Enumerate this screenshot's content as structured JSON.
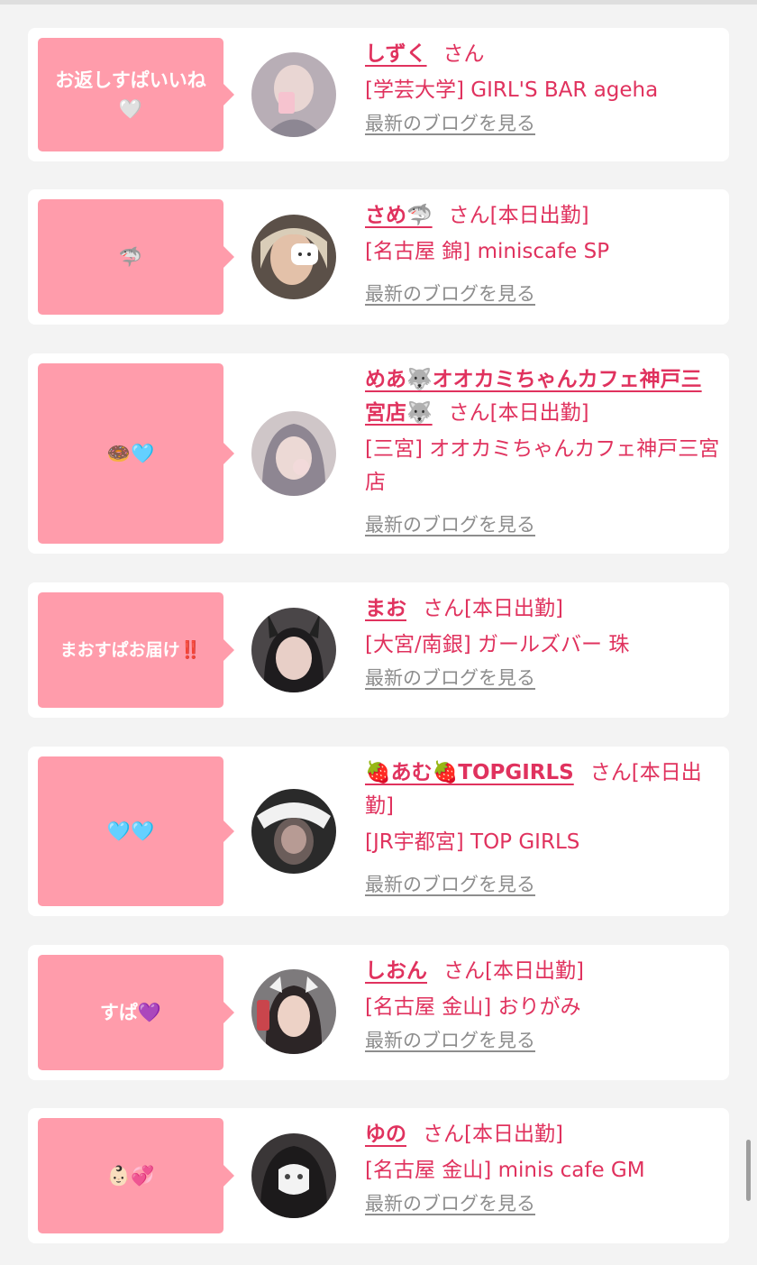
{
  "colors": {
    "accent": "#e0325e",
    "bubble": "#ff9cab",
    "link_gray": "#8d8d8d"
  },
  "blog_link_label": "最新のブログを見る",
  "entries": [
    {
      "message": "お返しすぱいいね🤍",
      "name": "しずく",
      "suffix": "さん",
      "shop": "[学芸大学] GIRL'S BAR ageha"
    },
    {
      "message": "🦈",
      "name": "さめ🦈",
      "suffix": "さん[本日出勤]",
      "shop": "[名古屋 錦] miniscafe SP"
    },
    {
      "message": "🍩🩵",
      "name": "めあ🐺オオカミちゃんカフェ神戸三宮店🐺",
      "suffix": "さん[本日出勤]",
      "shop": "[三宮] オオカミちゃんカフェ神戸三宮店"
    },
    {
      "message": "まおすぱお届け‼️",
      "name": "まお",
      "suffix": "さん[本日出勤]",
      "shop": "[大宮/南銀] ガールズバー 珠"
    },
    {
      "message": "🩵🩵",
      "name": "🍓あむ🍓TOPGIRLS",
      "suffix": "さん[本日出勤]",
      "shop": "[JR宇都宮] TOP GIRLS"
    },
    {
      "message": "すぱ💜",
      "name": "しおん",
      "suffix": "さん[本日出勤]",
      "shop": "[名古屋 金山] おりがみ"
    },
    {
      "message": "👶🏻💞",
      "name": "ゆの",
      "suffix": "さん[本日出勤]",
      "shop": "[名古屋 金山] minis cafe GM"
    }
  ]
}
